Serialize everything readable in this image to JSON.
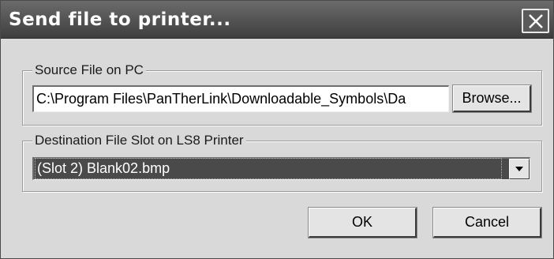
{
  "window": {
    "title": "Send file to printer...",
    "close_icon": "close-icon"
  },
  "source": {
    "legend": "Source File on PC",
    "path_value": "C:\\Program Files\\PanTherLink\\Downloadable_Symbols\\Da",
    "browse_label": "Browse..."
  },
  "destination": {
    "legend": "Destination File Slot on LS8 Printer",
    "selected": "(Slot 2)  Blank02.bmp",
    "arrow_icon": "chevron-down-icon"
  },
  "actions": {
    "ok_label": "OK",
    "cancel_label": "Cancel"
  }
}
